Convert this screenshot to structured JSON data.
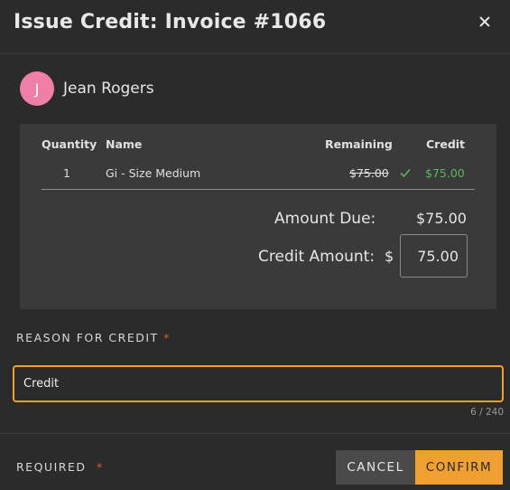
{
  "dialog": {
    "title": "Issue Credit: Invoice #1066",
    "close_icon": "close-icon"
  },
  "customer": {
    "initial": "J",
    "name": "Jean Rogers",
    "avatar_color": "#ef7fa8"
  },
  "table": {
    "headers": {
      "quantity": "Quantity",
      "name": "Name",
      "remaining": "Remaining",
      "credit": "Credit"
    },
    "rows": [
      {
        "quantity": "1",
        "name": "Gi - Size Medium",
        "remaining": "$75.00",
        "status_icon": "check-icon",
        "credit": "$75.00"
      }
    ]
  },
  "summary": {
    "amount_due_label": "Amount Due:",
    "amount_due_value": "$75.00",
    "credit_amount_label": "Credit Amount:",
    "currency_symbol": "$",
    "credit_amount_value": "75.00"
  },
  "reason": {
    "label": "REASON FOR CREDIT",
    "required_marker": "*",
    "value": "Credit",
    "char_count": "6 / 240"
  },
  "footer": {
    "required_label": "REQUIRED",
    "required_marker": "*",
    "cancel_label": "CANCEL",
    "confirm_label": "CONFIRM"
  },
  "colors": {
    "background": "#2b2b2b",
    "panel": "#3a3a3a",
    "accent": "#f0a030",
    "success": "#5cb85c",
    "required": "#e0582f"
  }
}
